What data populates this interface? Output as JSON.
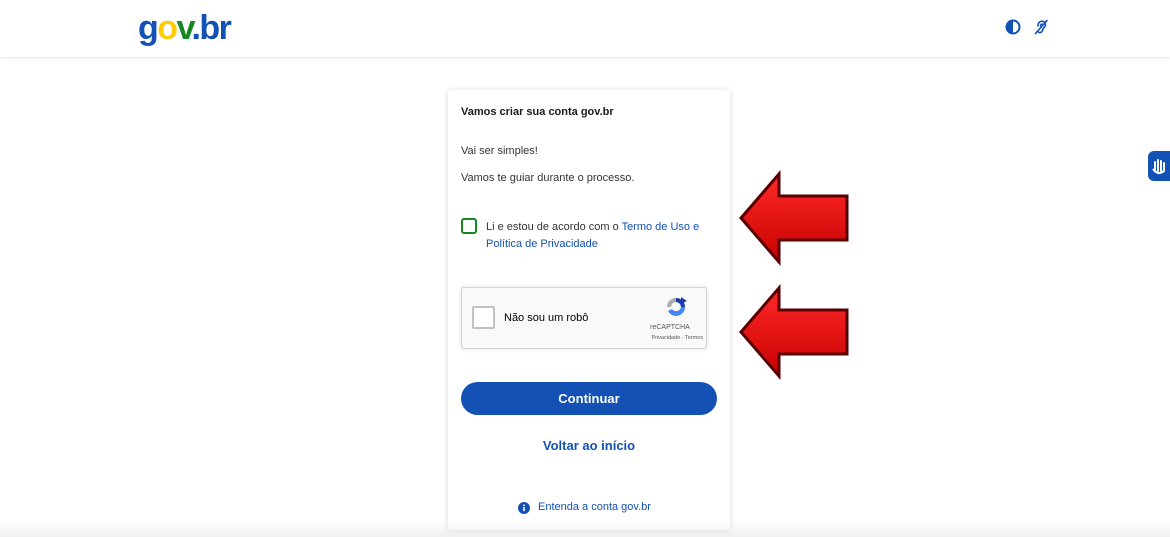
{
  "header": {
    "logo": {
      "g": "g",
      "o": "o",
      "v": "v",
      "dot": ".",
      "br": "br"
    },
    "contrast_icon": "contrast-icon",
    "accessibility_icon": "hearing-accessibility-icon"
  },
  "card": {
    "title": "Vamos criar sua conta gov.br",
    "text1": "Vai ser simples!",
    "text2": "Vamos te guiar durante o processo.",
    "terms": {
      "prefix": "Li e estou de acordo com o ",
      "link": "Termo de Uso e Política de Privacidade"
    },
    "recaptcha": {
      "label": "Não sou um robô",
      "brand": "reCAPTCHA",
      "links": "Privacidade - Termos"
    },
    "continue_label": "Continuar",
    "back_label": "Voltar ao início",
    "info_label": "Entenda a conta gov.br"
  },
  "colors": {
    "primary": "#1351b4",
    "logo_yellow": "#ffcd07",
    "logo_green": "#168821",
    "arrow_red": "#e00000",
    "checkbox_border": "#168821"
  }
}
